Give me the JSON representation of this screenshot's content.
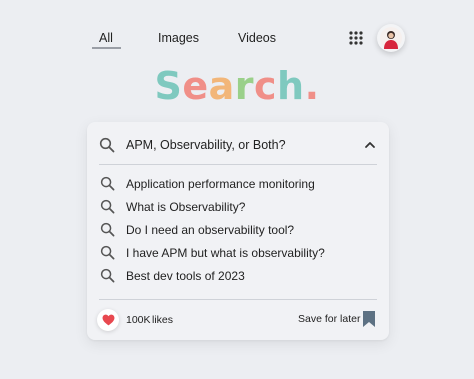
{
  "nav": {
    "tabs": [
      {
        "label": "All",
        "active": true
      },
      {
        "label": "Images",
        "active": false
      },
      {
        "label": "Videos",
        "active": false
      }
    ]
  },
  "icons": {
    "apps": "apps-grid-icon",
    "avatar": "user-avatar",
    "search": "search-icon",
    "collapse": "chevron-up-icon",
    "like": "heart-icon",
    "save": "bookmark-icon"
  },
  "logo": {
    "letters": [
      {
        "char": "S",
        "color": "#7fc9bf"
      },
      {
        "char": "e",
        "color": "#f08f88"
      },
      {
        "char": "a",
        "color": "#f2b679"
      },
      {
        "char": "r",
        "color": "#9ad08a"
      },
      {
        "char": "c",
        "color": "#f08f88"
      },
      {
        "char": "h",
        "color": "#7fc9bf"
      },
      {
        "char": ".",
        "color": "#f08f88"
      }
    ]
  },
  "search": {
    "query": "APM, Observability, or Both?"
  },
  "suggestions": [
    {
      "label": "Application performance monitoring"
    },
    {
      "label": "What is Observability?"
    },
    {
      "label": "Do I need an observability tool?"
    },
    {
      "label": "I have APM but what is observability?"
    },
    {
      "label": "Best dev tools of 2023"
    }
  ],
  "footer": {
    "likes_count": "100K",
    "likes_label": "likes",
    "save_label": "Save for later"
  },
  "colors": {
    "background": "#eceef2",
    "card": "#f1f2f5",
    "heart": "#e8484f",
    "bookmark": "#5d7183"
  }
}
